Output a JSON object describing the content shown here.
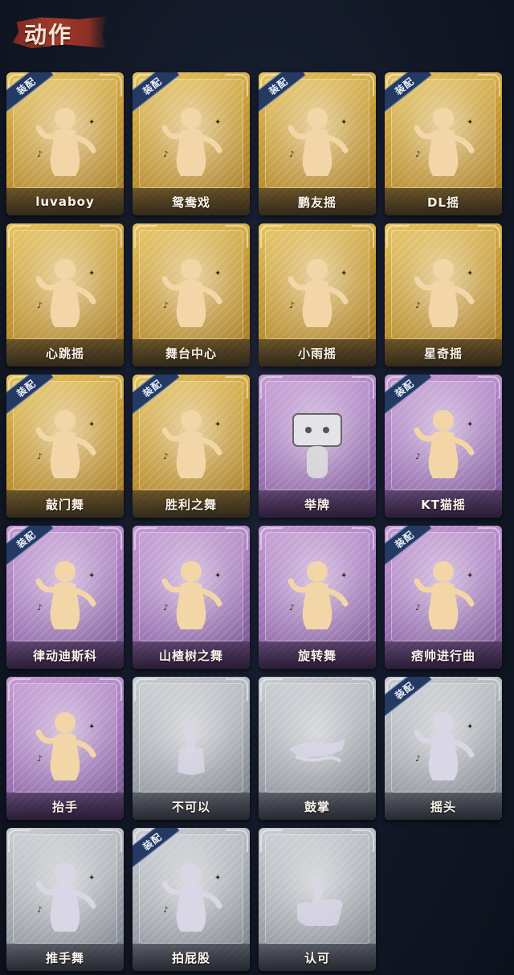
{
  "header": {
    "title": "动作"
  },
  "cards": [
    {
      "label": "luvaboy",
      "tier": "gold",
      "equipped": true,
      "icon": "dancer-silhouette-icon"
    },
    {
      "label": "鸳鸯戏",
      "tier": "gold",
      "equipped": true,
      "icon": "dancer-silhouette-icon"
    },
    {
      "label": "鹏友摇",
      "tier": "gold",
      "equipped": true,
      "icon": "dancer-silhouette-icon"
    },
    {
      "label": "DL摇",
      "tier": "gold",
      "equipped": true,
      "icon": "dancer-silhouette-icon"
    },
    {
      "label": "心跳摇",
      "tier": "gold",
      "equipped": false,
      "icon": "dancer-silhouette-icon"
    },
    {
      "label": "舞台中心",
      "tier": "gold",
      "equipped": false,
      "icon": "dancer-silhouette-icon"
    },
    {
      "label": "小雨摇",
      "tier": "gold",
      "equipped": false,
      "icon": "dancer-silhouette-icon"
    },
    {
      "label": "星奇摇",
      "tier": "gold",
      "equipped": false,
      "icon": "dancer-silhouette-icon"
    },
    {
      "label": "敲门舞",
      "tier": "gold",
      "equipped": true,
      "icon": "dancer-silhouette-icon"
    },
    {
      "label": "胜利之舞",
      "tier": "gold",
      "equipped": true,
      "icon": "dancer-silhouette-icon"
    },
    {
      "label": "举牌",
      "tier": "purple",
      "equipped": false,
      "icon": "sign-holder-icon"
    },
    {
      "label": "KT猫摇",
      "tier": "purple",
      "equipped": true,
      "icon": "dancer-silhouette-icon"
    },
    {
      "label": "律动迪斯科",
      "tier": "purple",
      "equipped": true,
      "icon": "dancer-silhouette-icon"
    },
    {
      "label": "山楂树之舞",
      "tier": "purple",
      "equipped": false,
      "icon": "dancer-silhouette-icon"
    },
    {
      "label": "旋转舞",
      "tier": "purple",
      "equipped": false,
      "icon": "dancer-silhouette-icon"
    },
    {
      "label": "痞帅进行曲",
      "tier": "purple",
      "equipped": true,
      "icon": "dancer-silhouette-icon"
    },
    {
      "label": "抬手",
      "tier": "purple",
      "equipped": false,
      "icon": "raise-hand-icon"
    },
    {
      "label": "不可以",
      "tier": "gray",
      "equipped": false,
      "icon": "finger-wag-icon"
    },
    {
      "label": "鼓掌",
      "tier": "gray",
      "equipped": false,
      "icon": "clap-hands-icon"
    },
    {
      "label": "摇头",
      "tier": "gray",
      "equipped": true,
      "icon": "shake-head-icon"
    },
    {
      "label": "推手舞",
      "tier": "gray",
      "equipped": false,
      "icon": "push-hands-icon"
    },
    {
      "label": "拍屁股",
      "tier": "gray",
      "equipped": true,
      "icon": "slap-dance-icon"
    },
    {
      "label": "认可",
      "tier": "gray",
      "equipped": false,
      "icon": "thumbs-up-icon"
    }
  ],
  "badge_label": "装配",
  "colors": {
    "gold": "#c79c35",
    "purple": "#a97fc0",
    "gray": "#a7abb2",
    "badge": "#243a63",
    "header_brush": "#a33a2b"
  }
}
